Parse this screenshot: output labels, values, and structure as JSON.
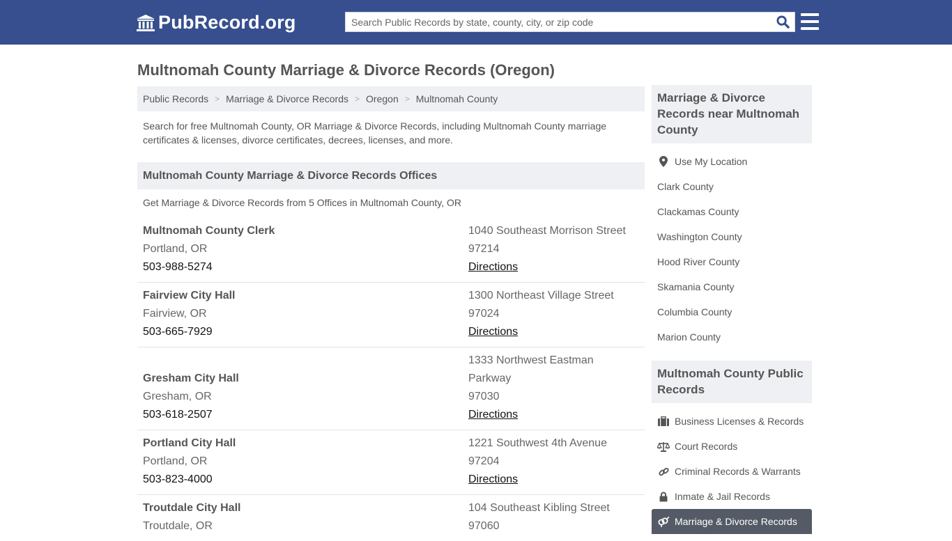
{
  "header": {
    "logo_text": "PubRecord.org",
    "search_placeholder": "Search Public Records by state, county, city, or zip code"
  },
  "page_title": "Multnomah County Marriage & Divorce Records (Oregon)",
  "breadcrumb": [
    {
      "label": "Public Records"
    },
    {
      "label": "Marriage & Divorce Records"
    },
    {
      "label": "Oregon"
    },
    {
      "label": "Multnomah County"
    }
  ],
  "intro": "Search for free Multnomah County, OR Marriage & Divorce Records, including Multnomah County marriage certificates & licenses, divorce certificates, decrees, licenses, and more.",
  "offices_section": {
    "title": "Multnomah County Marriage & Divorce Records Offices",
    "subtitle": "Get Marriage & Divorce Records from 5 Offices in Multnomah County, OR",
    "offices": [
      {
        "name": "Multnomah County Clerk",
        "city": "Portland, OR",
        "phone": "503-988-5274",
        "address": [
          "1040 Southeast Morrison Street",
          "97214"
        ],
        "directions": "Directions"
      },
      {
        "name": "Fairview City Hall",
        "city": "Fairview, OR",
        "phone": "503-665-7929",
        "address": [
          "1300 Northeast Village Street",
          "97024"
        ],
        "directions": "Directions"
      },
      {
        "name": "Gresham City Hall",
        "city": "Gresham, OR",
        "phone": "503-618-2507",
        "address": [
          "1333 Northwest Eastman",
          "Parkway",
          "97030"
        ],
        "directions": "Directions"
      },
      {
        "name": "Portland City Hall",
        "city": "Portland, OR",
        "phone": "503-823-4000",
        "address": [
          "1221 Southwest 4th Avenue",
          "97204"
        ],
        "directions": "Directions"
      },
      {
        "name": "Troutdale City Hall",
        "city": "Troutdale, OR",
        "phone": "",
        "address": [
          "104 Southeast Kibling Street",
          "97060"
        ],
        "directions": ""
      }
    ]
  },
  "sidebar": {
    "nearby_title": "Marriage & Divorce Records near Multnomah County",
    "use_location": "Use My Location",
    "nearby": [
      "Clark County",
      "Clackamas County",
      "Washington County",
      "Hood River County",
      "Skamania County",
      "Columbia County",
      "Marion County"
    ],
    "public_title": "Multnomah County Public Records",
    "public_records": [
      {
        "label": "Business Licenses & Records",
        "icon": "briefcase-icon"
      },
      {
        "label": "Court Records",
        "icon": "scale-icon"
      },
      {
        "label": "Criminal Records & Warrants",
        "icon": "link-icon"
      },
      {
        "label": "Inmate & Jail Records",
        "icon": "lock-icon"
      },
      {
        "label": "Marriage & Divorce Records",
        "icon": "gender-icon",
        "active": true
      }
    ]
  }
}
